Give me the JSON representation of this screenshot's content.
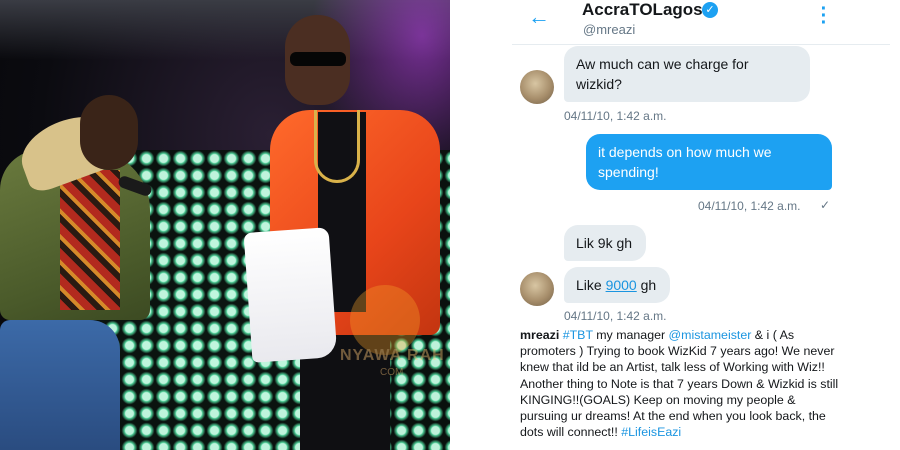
{
  "photo": {
    "watermark": "NYAWA RAH",
    "watermark_sub": "COM"
  },
  "dm": {
    "header": {
      "name": "AccraTOLagos",
      "handle": "@mreazi"
    },
    "messages": [
      {
        "direction": "in",
        "text": "Aw much can we charge for wizkid?",
        "timestamp": "04/11/10, 1:42 a.m."
      },
      {
        "direction": "out",
        "text": "it depends on how much we spending!",
        "timestamp": "04/11/10, 1:42 a.m."
      },
      {
        "direction": "in",
        "text": "Lik 9k gh",
        "timestamp": ""
      },
      {
        "direction": "in",
        "text_prefix": "Like ",
        "link": "9000",
        "text_suffix": " gh",
        "timestamp": "04/11/10, 1:42 a.m."
      }
    ],
    "caption": {
      "user": "mreazi",
      "hashtag": "#TBT",
      "part1": " my manager ",
      "mention": "@mistameister",
      "part2": " & i ( As promoters ) Trying to book WizKid 7 years ago! We never knew that ild be an Artist, talk less of Working with Wiz!! Another thing to Note is that 7 years Down & Wizkid is still KINGING!!(GOALS)  Keep on moving my people & pursuing ur dreams! At the end when you look back, the dots will connect!! ",
      "end_hashtag": "#LifeisEazi"
    }
  },
  "colors": {
    "accent": "#1da1f2",
    "bubble_in": "#e6ecf0",
    "timestamp": "#657786"
  },
  "icons": [
    "back-arrow-icon",
    "verified-icon",
    "more-vertical-icon",
    "checkmark-icon"
  ]
}
